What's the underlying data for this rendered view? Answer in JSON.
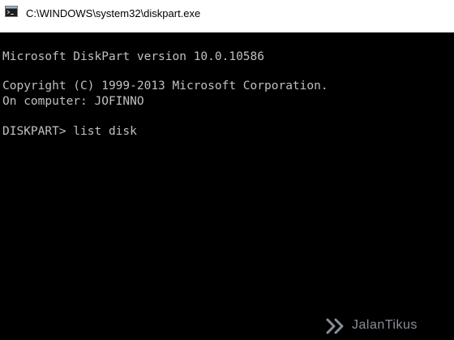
{
  "window": {
    "title": "C:\\WINDOWS\\system32\\diskpart.exe",
    "icon": "console-icon"
  },
  "console": {
    "lines": [
      "Microsoft DiskPart version 10.0.10586",
      "Copyright (C) 1999-2013 Microsoft Corporation.",
      "On computer: JOFINNO",
      "DISKPART> list disk"
    ]
  },
  "watermark": {
    "text": "JalanTikus",
    "icon": "jalantikus-logo-icon"
  },
  "colors": {
    "console_bg": "#000000",
    "console_text": "#c0c0c0",
    "titlebar_bg": "#ffffff",
    "watermark": "#8a8f97"
  }
}
